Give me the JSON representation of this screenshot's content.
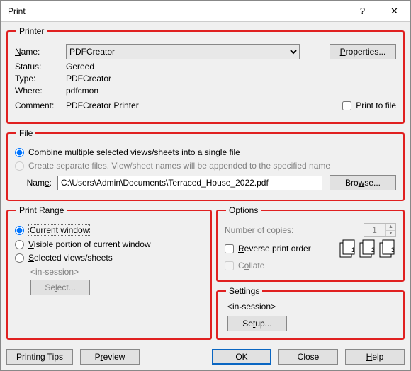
{
  "titlebar": {
    "title": "Print",
    "help": "?",
    "close": "✕"
  },
  "printer": {
    "legend": "Printer",
    "name_label": "Name:",
    "name_value": "PDFCreator",
    "properties_btn": "Properties...",
    "status_label": "Status:",
    "status_value": "Gereed",
    "type_label": "Type:",
    "type_value": "PDFCreator",
    "where_label": "Where:",
    "where_value": "pdfcmon",
    "comment_label": "Comment:",
    "comment_value": "PDFCreator Printer",
    "print_to_file": "Print to file"
  },
  "file": {
    "legend": "File",
    "opt_combine": "Combine multiple selected views/sheets into a single file",
    "opt_separate": "Create separate files. View/sheet names will be appended to the specified name",
    "name_label": "Name:",
    "path": "C:\\Users\\Admin\\Documents\\Terraced_House_2022.pdf",
    "browse_btn": "Browse..."
  },
  "range": {
    "legend": "Print Range",
    "opt_current": "Current window",
    "opt_visible": "Visible portion of current window",
    "opt_selected": "Selected views/sheets",
    "session": "<in-session>",
    "select_btn": "Select..."
  },
  "options": {
    "legend": "Options",
    "copies_label": "Number of copies:",
    "copies_value": "1",
    "reverse": "Reverse print order",
    "collate": "Collate"
  },
  "settings": {
    "legend": "Settings",
    "session": "<in-session>",
    "setup_btn": "Setup..."
  },
  "footer": {
    "tips": "Printing Tips",
    "preview": "Preview",
    "ok": "OK",
    "close": "Close",
    "help": "Help"
  }
}
